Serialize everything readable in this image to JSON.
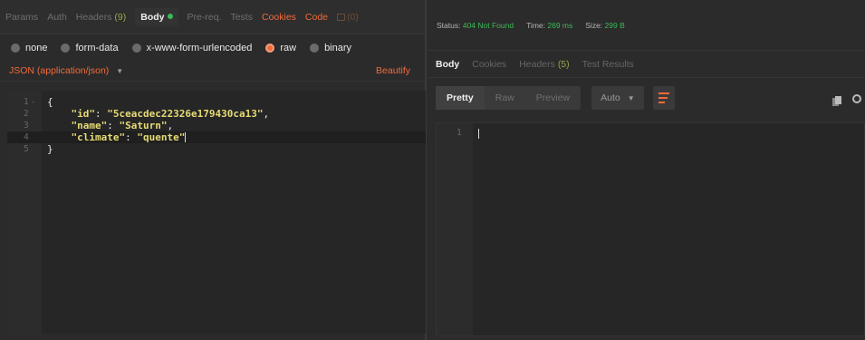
{
  "request_tabs": {
    "params": "Params",
    "auth": "Auth",
    "headers": "Headers",
    "headers_count": "(9)",
    "body": "Body",
    "prereq": "Pre-req.",
    "tests": "Tests",
    "cookies": "Cookies",
    "code": "Code",
    "comments_count": "(0)"
  },
  "body_types": [
    "none",
    "form-data",
    "x-www-form-urlencoded",
    "raw",
    "binary"
  ],
  "body_type_selected": "raw",
  "content_type": "JSON (application/json)",
  "beautify_label": "Beautify",
  "editor": {
    "lines": [
      {
        "num": "1",
        "fold": "-",
        "open": "{"
      },
      {
        "num": "2",
        "key": "\"id\"",
        "value": "\"5ceacdec22326e179430ca13\"",
        "trail": ","
      },
      {
        "num": "3",
        "key": "\"name\"",
        "value": "\"Saturn\"",
        "trail": ","
      },
      {
        "num": "4",
        "key": "\"climate\"",
        "value": "\"quente\"",
        "trail": ""
      },
      {
        "num": "5",
        "close": "}"
      }
    ]
  },
  "response": {
    "status_label": "Status:",
    "status_value": "404 Not Found",
    "time_label": "Time:",
    "time_value": "269 ms",
    "size_label": "Size:",
    "size_value": "299 B",
    "tabs": {
      "body": "Body",
      "cookies": "Cookies",
      "headers": "Headers",
      "headers_count": "(5)",
      "test_results": "Test Results"
    },
    "view_modes": [
      "Pretty",
      "Raw",
      "Preview"
    ],
    "format": "Auto",
    "line_num": "1"
  },
  "icons": {
    "wrap": "wrap-lines-icon",
    "copy": "copy-icon",
    "search": "search-icon",
    "comments": "speech-bubble-icon"
  },
  "colors": {
    "accent": "#f26b3a",
    "success": "#3cba58",
    "json_string": "#e6db74"
  }
}
